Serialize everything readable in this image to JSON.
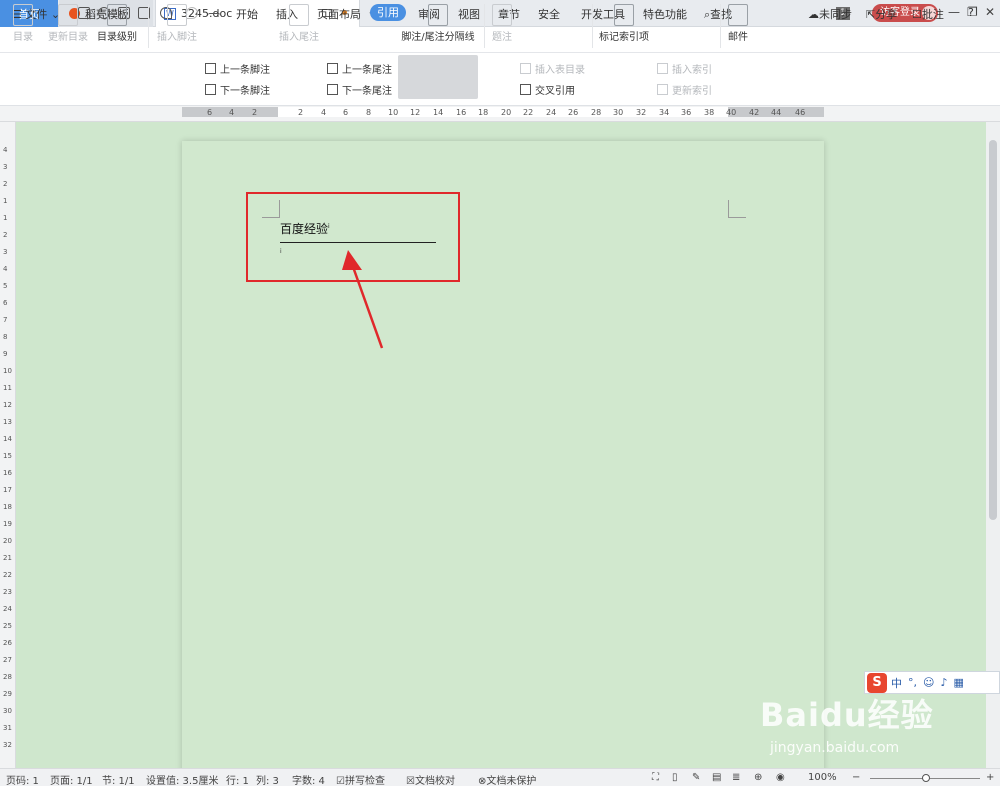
{
  "tabs": {
    "home": "首页",
    "template": "稻壳模板",
    "doc": "3245.doc",
    "add": "+"
  },
  "titlebar": {
    "badge": "1",
    "login": "访客登录",
    "minimize": "—",
    "maximize": "❐",
    "close": "✕"
  },
  "menu": {
    "file": "☰ 文件 ⌄",
    "tabs": [
      "开始",
      "插入",
      "页面布局",
      "引用",
      "审阅",
      "视图",
      "章节",
      "安全",
      "开发工具",
      "特色功能"
    ],
    "active_tab": "引用",
    "search": "查找",
    "sync": "未同步",
    "share": "分享",
    "comment": "批注",
    "help": "?"
  },
  "ribbon": {
    "toc": "目录",
    "update_toc": "更新目录",
    "toc_level": "目录级别",
    "insert_footnote": "插入脚注",
    "prev_footnote": "上一条脚注",
    "next_footnote": "下一条脚注",
    "insert_endnote": "插入尾注",
    "prev_endnote": "上一条尾注",
    "next_endnote": "下一条尾注",
    "separator": "脚注/尾注分隔线",
    "caption": "题注",
    "insert_table_of_figures": "插入表目录",
    "cross_ref": "交叉引用",
    "mark_index": "标记索引项",
    "insert_index": "插入索引",
    "update_index": "更新索引",
    "mail": "邮件"
  },
  "ruler": {
    "h_ticks": [
      "6",
      "4",
      "2",
      "2",
      "4",
      "6",
      "8",
      "10",
      "12",
      "14",
      "16",
      "18",
      "20",
      "22",
      "24",
      "26",
      "28",
      "30",
      "32",
      "34",
      "36",
      "38",
      "40",
      "42",
      "44",
      "46"
    ],
    "v_ticks": [
      "4",
      "3",
      "2",
      "1",
      "1",
      "2",
      "3",
      "4",
      "5",
      "6",
      "7",
      "8",
      "9",
      "10",
      "11",
      "12",
      "13",
      "14",
      "15",
      "16",
      "17",
      "18",
      "19",
      "20",
      "21",
      "22",
      "23",
      "24",
      "25",
      "26",
      "27",
      "28",
      "29",
      "30",
      "31",
      "32"
    ]
  },
  "document": {
    "text": "百度经验",
    "footnote_ref": "i",
    "footnote_mark": "i"
  },
  "ime": {
    "logo": "S",
    "lang": "中",
    "punct": "°,"
  },
  "watermark": {
    "brand": "Baidu经验",
    "url": "jingyan.baidu.com"
  },
  "status": {
    "page_no": "页码: 1",
    "pages": "页面: 1/1",
    "section": "节: 1/1",
    "setting": "设置值: 3.5厘米",
    "row": "行: 1",
    "col": "列: 3",
    "words": "字数: 4",
    "spell": "拼写检查",
    "proof": "文档校对",
    "protect": "文档未保护",
    "zoom": "100%"
  },
  "colors": {
    "accent": "#4a90e2",
    "page_bg": "#cfe7cd",
    "highlight": "#e0282b"
  }
}
